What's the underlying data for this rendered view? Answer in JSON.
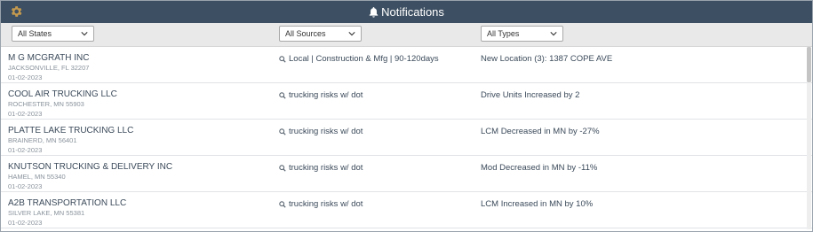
{
  "header": {
    "title": "Notifications",
    "settings_icon": "gear-icon",
    "title_icon": "bell-icon",
    "bg_color": "#3d4f62"
  },
  "filters": {
    "states": "All States",
    "sources": "All Sources",
    "types": "All Types"
  },
  "notifications": [
    {
      "company": "M G MCGRATH INC",
      "location": "JACKSONVILLE, FL 32207",
      "date": "01-02-2023",
      "source": "Local | Construction & Mfg | 90-120days",
      "type": "New Location (3): 1387 COPE AVE"
    },
    {
      "company": "COOL AIR TRUCKING LLC",
      "location": "ROCHESTER, MN 55903",
      "date": "01-02-2023",
      "source": "trucking risks w/ dot",
      "type": "Drive Units Increased by 2"
    },
    {
      "company": "PLATTE LAKE TRUCKING LLC",
      "location": "BRAINERD, MN 56401",
      "date": "01-02-2023",
      "source": "trucking risks w/ dot",
      "type": "LCM Decreased in MN by -27%"
    },
    {
      "company": "KNUTSON TRUCKING & DELIVERY INC",
      "location": "HAMEL, MN 55340",
      "date": "01-02-2023",
      "source": "trucking risks w/ dot",
      "type": "Mod Decreased in MN by -11%"
    },
    {
      "company": "A2B TRANSPORTATION LLC",
      "location": "SILVER LAKE, MN 55381",
      "date": "01-02-2023",
      "source": "trucking risks w/ dot",
      "type": "LCM Increased in MN by 10%"
    }
  ]
}
